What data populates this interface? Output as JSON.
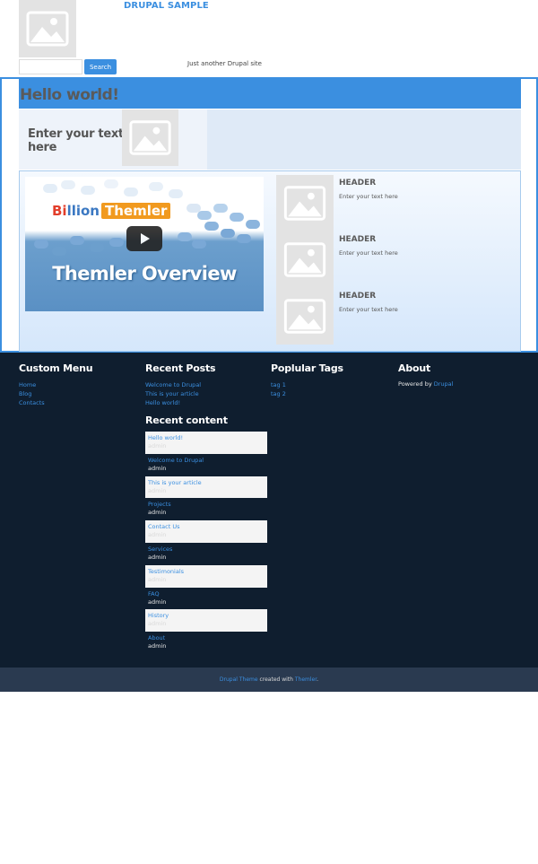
{
  "site": {
    "name": "DRUPAL SAMPLE",
    "slogan": "Just another Drupal site"
  },
  "search": {
    "placeholder": "",
    "button_label": "Search"
  },
  "main": {
    "title": "Hello world!",
    "intro_text": "Enter your text here",
    "video": {
      "brand_part1": "Bi",
      "brand_part2": "llion",
      "brand_box": "Themler",
      "title": "Themler Overview"
    },
    "features": [
      {
        "title": "HEADER",
        "text": "Enter your text here"
      },
      {
        "title": "HEADER",
        "text": "Enter your text here"
      },
      {
        "title": "HEADER",
        "text": "Enter your text here"
      }
    ]
  },
  "footer": {
    "custom_menu": {
      "title": "Custom Menu",
      "items": [
        "Home",
        "Blog",
        "Contacts"
      ]
    },
    "recent_posts": {
      "title": "Recent Posts",
      "items": [
        "Welcome to Drupal",
        "This is your article",
        "Hello world!"
      ]
    },
    "popular_tags": {
      "title": "Poplular Tags",
      "items": [
        "tag 1",
        "tag 2"
      ]
    },
    "about": {
      "title": "About",
      "text": "Powered by ",
      "link": "Drupal"
    },
    "recent_content": {
      "title": "Recent content",
      "items": [
        {
          "title": "Hello world!",
          "author": "admin"
        },
        {
          "title": "Welcome to Drupal",
          "author": "admin"
        },
        {
          "title": "This is your article",
          "author": "admin"
        },
        {
          "title": "Projects",
          "author": "admin"
        },
        {
          "title": "Contact Us",
          "author": "admin"
        },
        {
          "title": "Services",
          "author": "admin"
        },
        {
          "title": "Testimonials",
          "author": "admin"
        },
        {
          "title": "FAQ",
          "author": "admin"
        },
        {
          "title": "History",
          "author": "admin"
        },
        {
          "title": "About",
          "author": "admin"
        }
      ]
    }
  },
  "bottom": {
    "link1": "Drupal Theme",
    "middle": " created with ",
    "link2": "Themler",
    "end": "."
  },
  "colors": {
    "accent": "#3b8fe0",
    "footer_bg": "#0f1e2f",
    "bottom_bar_bg": "#2a3a50"
  }
}
